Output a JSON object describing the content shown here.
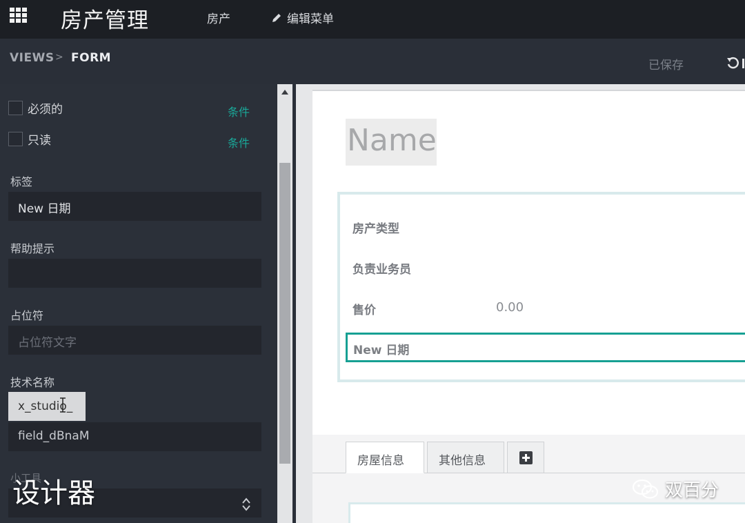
{
  "topbar": {
    "app_title": "房产管理",
    "nav_house": "房产",
    "nav_edit_menu": "编辑菜单"
  },
  "breadcrumb": {
    "views": "VIEWS",
    "separator": ">",
    "form": "FORM",
    "saved_status": "已保存"
  },
  "sidebar": {
    "required_label": "必须的",
    "required_condition": "条件",
    "readonly_label": "只读",
    "readonly_condition": "条件",
    "label_title": "标签",
    "label_value": "New 日期",
    "help_title": "帮助提示",
    "help_value": "",
    "placeholder_title": "占位符",
    "placeholder_hint": "占位符文字",
    "techname_title": "技术名称",
    "techname_prefix": "x_studio_",
    "techname_suffix": "field_dBnaM",
    "partial_label": "小工具"
  },
  "form": {
    "name_placeholder": "Name",
    "fields": [
      {
        "label": "房产类型"
      },
      {
        "label": "负责业务员"
      },
      {
        "label": "售价",
        "value": "0.00"
      }
    ],
    "new_date_field": "New 日期",
    "tabs": [
      "房屋信息",
      "其他信息"
    ]
  },
  "overlay": {
    "caption": "设计器",
    "watermark": "双百分"
  },
  "colors": {
    "accent_teal": "#16a093",
    "condition_link": "#1aa899",
    "topbar_bg": "#1c1f24",
    "sidebar_bg": "#2b3039"
  }
}
